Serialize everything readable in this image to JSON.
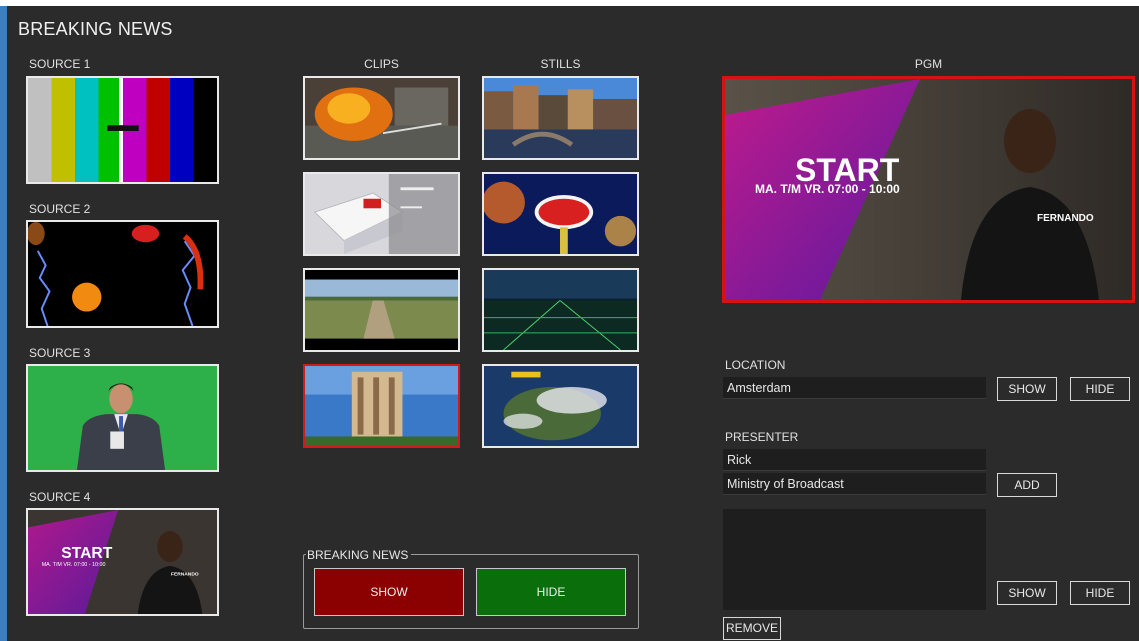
{
  "app": {
    "title": "BREAKING NEWS"
  },
  "sources": [
    {
      "label": "SOURCE 1",
      "thumb": "color-bars"
    },
    {
      "label": "SOURCE 2",
      "thumb": "fruit-lightning"
    },
    {
      "label": "SOURCE 3",
      "thumb": "presenter-greenscreen"
    },
    {
      "label": "SOURCE 4",
      "thumb": "start-promo",
      "promo_title": "START",
      "promo_subtitle": "MA. T/M VR. 07:00 - 10:00",
      "promo_name": "FERNANDO"
    }
  ],
  "clips": {
    "header": "CLIPS",
    "items": [
      "fire-scene",
      "3d-graphic",
      "aerial-road",
      "apartment-tower"
    ],
    "selected_index": 3
  },
  "stills": {
    "header": "STILLS",
    "items": [
      "amsterdam-canal",
      "las-vegas-sign",
      "city-night-lights",
      "satellite-weather-map"
    ]
  },
  "pgm": {
    "header": "PGM",
    "promo_title": "START",
    "promo_subtitle": "MA. T/M VR. 07:00 - 10:00",
    "promo_name": "FERNANDO"
  },
  "location": {
    "label": "LOCATION",
    "value": "Amsterdam",
    "show": "SHOW",
    "hide": "HIDE"
  },
  "presenter": {
    "label": "PRESENTER",
    "name": "Rick",
    "organization": "Ministry of Broadcast",
    "add": "ADD",
    "show": "SHOW",
    "hide": "HIDE",
    "remove": "REMOVE"
  },
  "breaking_news": {
    "label": "BREAKING NEWS",
    "show": "SHOW",
    "hide": "HIDE"
  },
  "colors": {
    "accent_strip": "#3a7fc1",
    "pgm_border": "#d41414",
    "show_red": "#8b0000",
    "hide_green": "#0a6e0a",
    "background": "#2b2b2b"
  }
}
